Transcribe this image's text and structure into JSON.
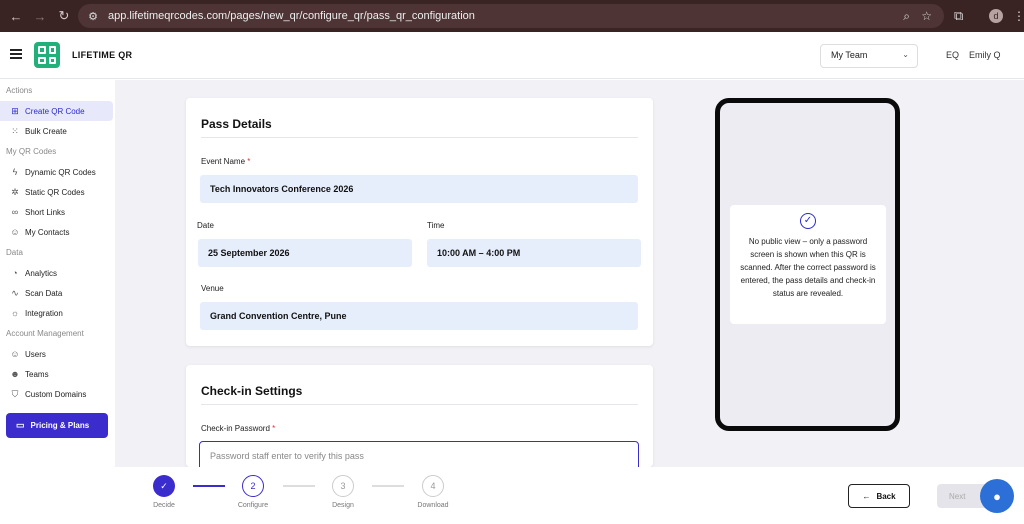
{
  "browser": {
    "url": "app.lifetimeqrcodes.com/pages/new_qr/configure_qr/pass_qr_configuration",
    "profile_initial": "d"
  },
  "header": {
    "brand": "LIFETIME QR",
    "team_select": "My Team",
    "user_initials": "EQ",
    "user_name": "Emily Q"
  },
  "sidebar": {
    "sections": {
      "actions": "Actions",
      "my_qr": "My QR Codes",
      "data": "Data",
      "account": "Account Management"
    },
    "items": {
      "create_qr": "Create QR Code",
      "bulk_create": "Bulk Create",
      "dynamic": "Dynamic QR Codes",
      "static": "Static QR Codes",
      "short_links": "Short Links",
      "contacts": "My Contacts",
      "analytics": "Analytics",
      "scan_data": "Scan Data",
      "integration": "Integration",
      "users": "Users",
      "teams": "Teams",
      "domains": "Custom Domains"
    },
    "pricing": "Pricing & Plans"
  },
  "pass_details": {
    "title": "Pass Details",
    "event_name_label": "Event Name",
    "event_name_value": "Tech Innovators Conference 2026",
    "date_label": "Date",
    "date_value": "25 September 2026",
    "time_label": "Time",
    "time_value": "10:00 AM – 4:00 PM",
    "venue_label": "Venue",
    "venue_value": "Grand Convention Centre, Pune"
  },
  "checkin": {
    "title": "Check-in Settings",
    "password_label": "Check-in Password",
    "password_placeholder": "Password staff enter to verify this pass"
  },
  "required_mark": "*",
  "preview": {
    "notice": "No public view – only a password screen is shown when this QR is scanned. After the correct password is entered, the pass details and check-in status are revealed."
  },
  "steps": [
    {
      "num": "✓",
      "label": "Decide"
    },
    {
      "num": "2",
      "label": "Configure"
    },
    {
      "num": "3",
      "label": "Design"
    },
    {
      "num": "4",
      "label": "Download"
    }
  ],
  "footer": {
    "back": "Back",
    "next": "Next"
  },
  "colors": {
    "accent": "#3b2ccd",
    "brand_green": "#22b07a",
    "field_bg": "#e6edfb"
  }
}
